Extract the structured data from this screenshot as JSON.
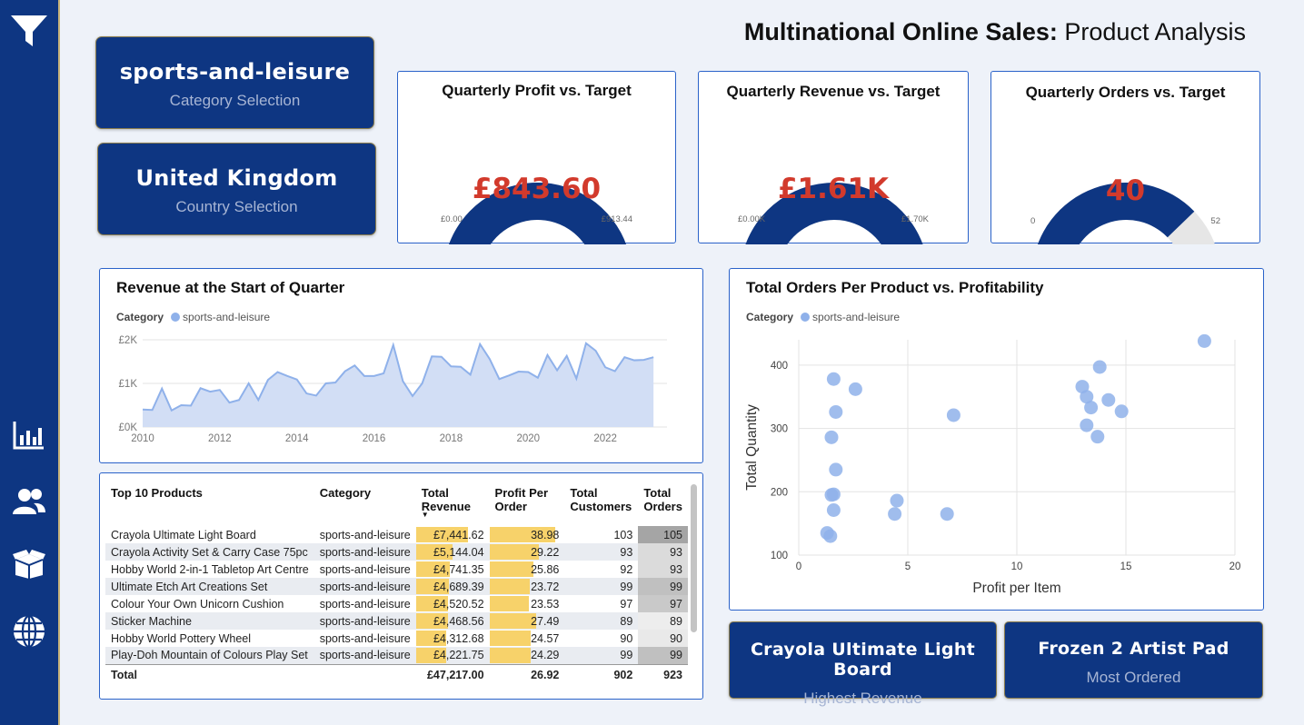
{
  "title": {
    "bold": "Multinational Online Sales:",
    "rest": " Product Analysis"
  },
  "sidebar": {
    "icons": [
      "filter-icon",
      "bar-chart-icon",
      "users-icon",
      "box-icon",
      "globe-icon"
    ]
  },
  "selections": {
    "category": {
      "value": "sports-and-leisure",
      "label": "Category Selection"
    },
    "country": {
      "value": "United Kingdom",
      "label": "Country Selection"
    }
  },
  "gauges": [
    {
      "title": "Quarterly Profit vs. Target",
      "value_label": "£843.60",
      "min_label": "£0.00",
      "max_label": "£913.44",
      "fraction": 0.923
    },
    {
      "title": "Quarterly Revenue vs. Target",
      "value_label": "£1.61K",
      "min_label": "£0.00K",
      "max_label": "£1.70K",
      "fraction": 0.947
    },
    {
      "title": "Quarterly Orders vs. Target",
      "value_label": "40",
      "min_label": "0",
      "max_label": "52",
      "fraction": 0.769
    }
  ],
  "colors": {
    "navy": "#0e3682",
    "accent_red": "#d23a2c",
    "area_fill": "#d2def5",
    "area_line": "#8fb1ea",
    "bar_yellow": "#f7d26a"
  },
  "line_chart": {
    "title": "Revenue at the Start of Quarter",
    "legend_label": "Category",
    "legend_item": "sports-and-leisure"
  },
  "scatter_chart": {
    "title": "Total Orders Per Product vs. Profitability",
    "legend_label": "Category",
    "legend_item": "sports-and-leisure"
  },
  "chart_data": [
    {
      "type": "area",
      "title": "Revenue at the Start of Quarter",
      "series": [
        {
          "name": "sports-and-leisure",
          "values": [
            400,
            390,
            880,
            380,
            500,
            490,
            890,
            810,
            850,
            560,
            620,
            1000,
            620,
            1080,
            1260,
            1170,
            1090,
            770,
            720,
            1000,
            1020,
            1280,
            1410,
            1170,
            1170,
            1230,
            1880,
            1050,
            710,
            1000,
            1620,
            1610,
            1390,
            1380,
            1200,
            1900,
            1560,
            1100,
            1180,
            1270,
            1260,
            1130,
            1650,
            1300,
            1630,
            1110,
            1920,
            1750,
            1370,
            1280,
            1600,
            1530,
            1540,
            1600
          ]
        }
      ],
      "x_start": 2010.0,
      "x_step": 0.25,
      "x_ticks": [
        "2010",
        "2012",
        "2014",
        "2016",
        "2018",
        "2020",
        "2022"
      ],
      "y_ticks": [
        "£0K",
        "£1K",
        "£2K"
      ],
      "xlim": [
        2010,
        2023.6
      ],
      "ylim": [
        0,
        2000
      ],
      "grid": true
    },
    {
      "type": "scatter",
      "title": "Total Orders Per Product vs. Profitability",
      "xlabel": "Profit per Item",
      "ylabel": "Total Quantity",
      "x_ticks": [
        "0",
        "5",
        "10",
        "15",
        "20"
      ],
      "y_ticks": [
        "100",
        "200",
        "300",
        "400"
      ],
      "xlim": [
        0,
        20
      ],
      "ylim": [
        100,
        440
      ],
      "series": [
        {
          "name": "sports-and-leisure",
          "points": [
            [
              18.6,
              438
            ],
            [
              13.8,
              397
            ],
            [
              13.0,
              366
            ],
            [
              13.2,
              350
            ],
            [
              13.4,
              333
            ],
            [
              14.2,
              345
            ],
            [
              14.8,
              327
            ],
            [
              13.2,
              305
            ],
            [
              13.7,
              287
            ],
            [
              1.6,
              378
            ],
            [
              2.6,
              362
            ],
            [
              1.7,
              326
            ],
            [
              7.1,
              321
            ],
            [
              1.5,
              286
            ],
            [
              1.7,
              235
            ],
            [
              1.5,
              195
            ],
            [
              1.6,
              196
            ],
            [
              1.6,
              171
            ],
            [
              4.5,
              186
            ],
            [
              4.4,
              165
            ],
            [
              6.8,
              165
            ],
            [
              1.3,
              135
            ],
            [
              1.45,
              130
            ]
          ]
        }
      ],
      "grid": true
    }
  ],
  "table": {
    "headers": [
      "Top 10 Products",
      "Category",
      "Total Revenue",
      "Profit Per Order",
      "Total Customers",
      "Total Orders"
    ],
    "rows": [
      {
        "product": "Crayola Ultimate Light Board",
        "category": "sports-and-leisure",
        "revenue": "£7,441.62",
        "revenue_frac": 0.99,
        "profit": "38.98",
        "profit_frac": 1.0,
        "customers": "103",
        "orders": "105"
      },
      {
        "product": "Crayola Activity Set & Carry Case 75pc",
        "category": "sports-and-leisure",
        "revenue": "£5,144.04",
        "revenue_frac": 0.69,
        "profit": "29.22",
        "profit_frac": 0.75,
        "customers": "93",
        "orders": "93"
      },
      {
        "product": "Hobby World 2-in-1 Tabletop Art Centre",
        "category": "sports-and-leisure",
        "revenue": "£4,741.35",
        "revenue_frac": 0.64,
        "profit": "25.86",
        "profit_frac": 0.66,
        "customers": "92",
        "orders": "93"
      },
      {
        "product": "Ultimate Etch Art Creations Set",
        "category": "sports-and-leisure",
        "revenue": "£4,689.39",
        "revenue_frac": 0.63,
        "profit": "23.72",
        "profit_frac": 0.61,
        "customers": "99",
        "orders": "99"
      },
      {
        "product": "Colour Your Own Unicorn Cushion",
        "category": "sports-and-leisure",
        "revenue": "£4,520.52",
        "revenue_frac": 0.61,
        "profit": "23.53",
        "profit_frac": 0.6,
        "customers": "97",
        "orders": "97"
      },
      {
        "product": "Sticker Machine",
        "category": "sports-and-leisure",
        "revenue": "£4,468.56",
        "revenue_frac": 0.6,
        "profit": "27.49",
        "profit_frac": 0.71,
        "customers": "89",
        "orders": "89"
      },
      {
        "product": "Hobby World Pottery Wheel",
        "category": "sports-and-leisure",
        "revenue": "£4,312.68",
        "revenue_frac": 0.58,
        "profit": "24.57",
        "profit_frac": 0.63,
        "customers": "90",
        "orders": "90"
      },
      {
        "product": "Play-Doh Mountain of Colours Play Set",
        "category": "sports-and-leisure",
        "revenue": "£4,221.75",
        "revenue_frac": 0.57,
        "profit": "24.29",
        "profit_frac": 0.62,
        "customers": "99",
        "orders": "99"
      }
    ],
    "total": {
      "label": "Total",
      "revenue": "£47,217.00",
      "profit": "26.92",
      "customers": "902",
      "orders": "923"
    },
    "sort_indicator": "▼"
  },
  "kpis": [
    {
      "value": "Crayola Ultimate Light Board",
      "label": "Highest Revenue"
    },
    {
      "value": "Frozen 2 Artist Pad",
      "label": "Most Ordered"
    }
  ]
}
